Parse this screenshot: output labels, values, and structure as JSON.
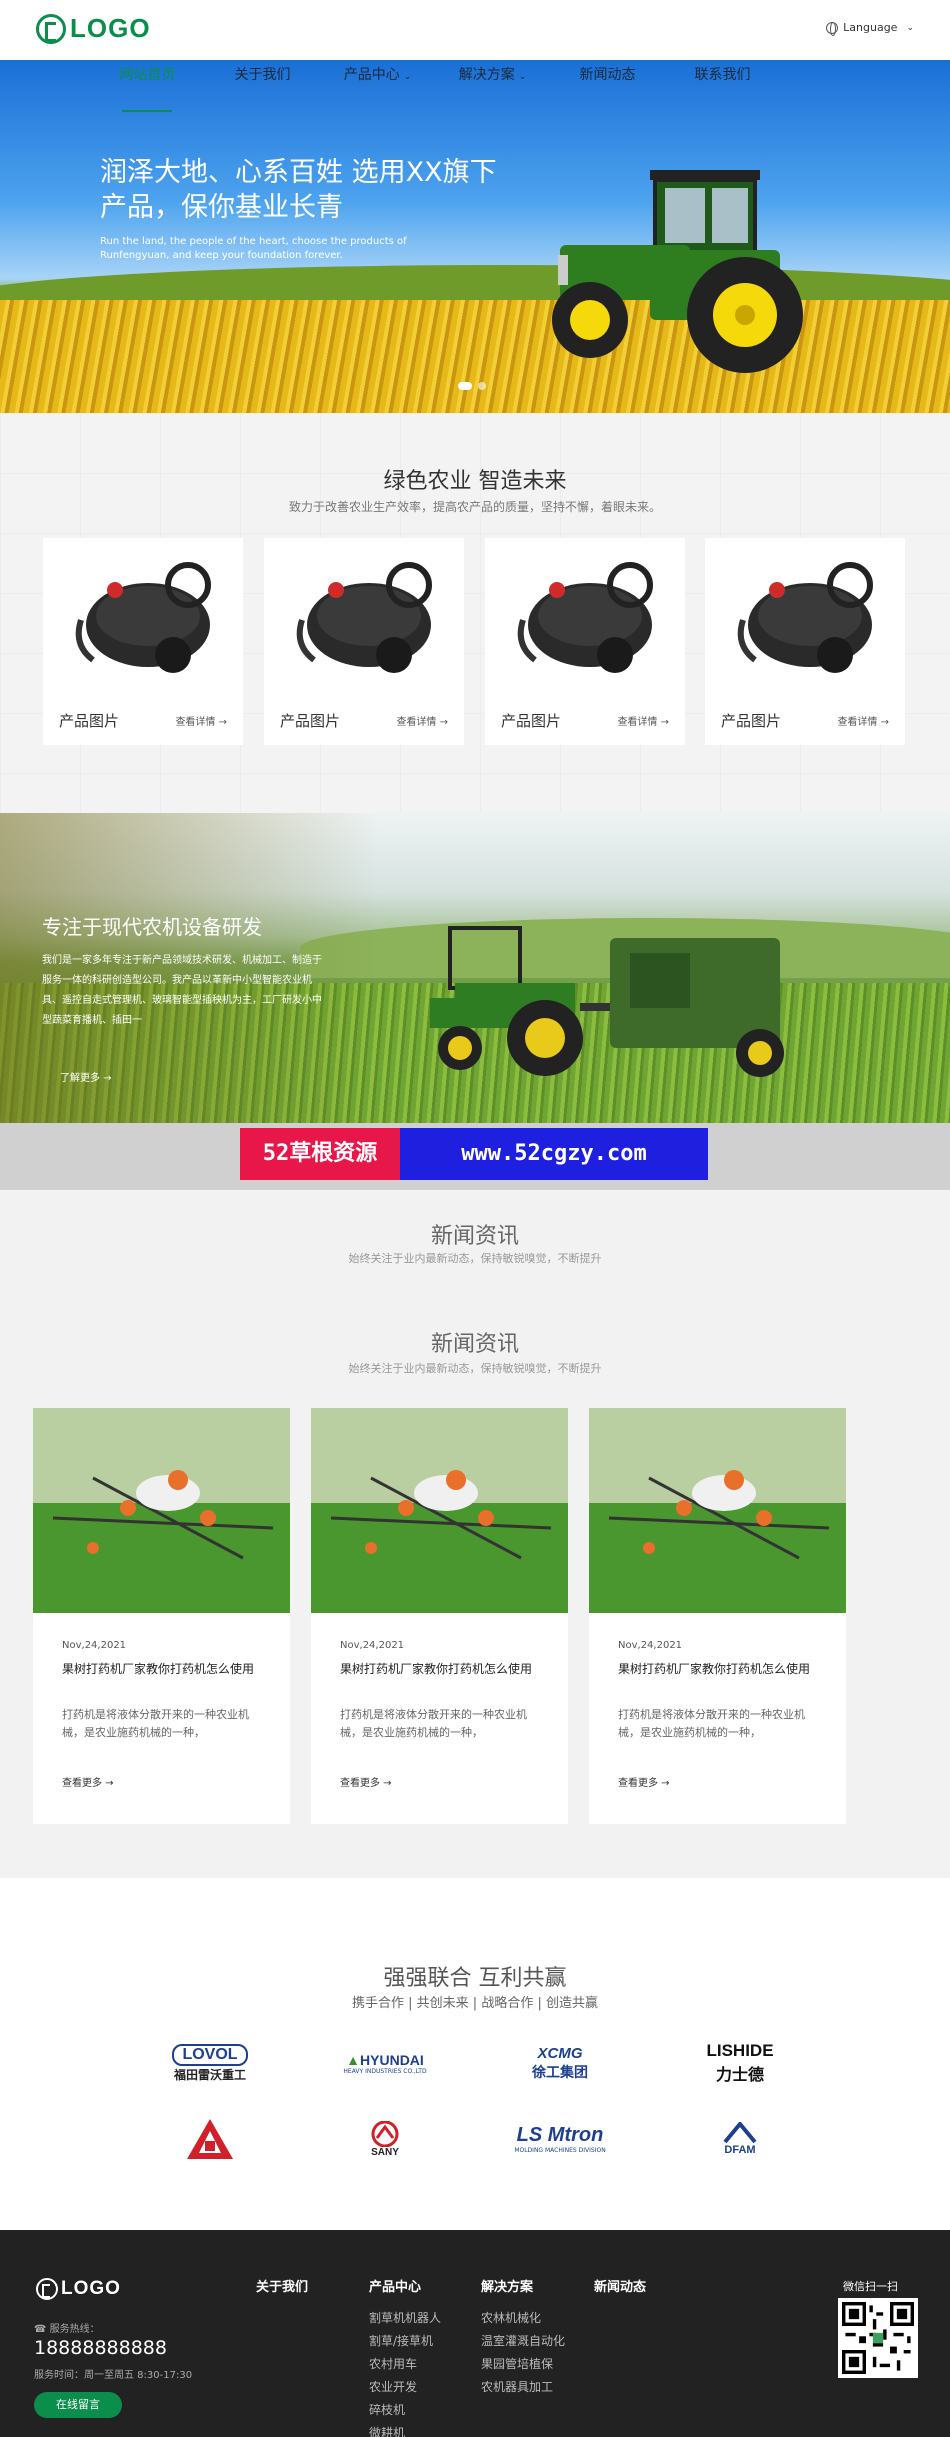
{
  "header": {
    "logo_text": "LOGO",
    "language_label": "Language"
  },
  "nav": {
    "items": [
      {
        "label": "网站首页",
        "active": true
      },
      {
        "label": "关于我们"
      },
      {
        "label": "产品中心",
        "has_dropdown": true
      },
      {
        "label": "解决方案",
        "has_dropdown": true
      },
      {
        "label": "新闻动态"
      },
      {
        "label": "联系我们"
      }
    ]
  },
  "hero": {
    "title": "润泽大地、心系百姓 选用XX旗下产品，保你基业长青",
    "subtitle": "Run the land, the people of the heart, choose the products of Runfengyuan, and keep your foundation forever."
  },
  "products": {
    "title": "绿色农业 智造未来",
    "subtitle": "致力于改善农业生产效率，提高农产品的质量，坚持不懈，着眼未来。",
    "items": [
      {
        "label": "产品图片",
        "more": "查看详情"
      },
      {
        "label": "产品图片",
        "more": "查看详情"
      },
      {
        "label": "产品图片",
        "more": "查看详情"
      },
      {
        "label": "产品图片",
        "more": "查看详情"
      }
    ]
  },
  "feature": {
    "title": "专注于现代农机设备研发",
    "text": "我们是一家多年专注于新产品领域技术研发、机械加工、制造于服务一体的科研创造型公司。我产品以革新中小型智能农业机具、遥控自走式管理机、玻璃智能型插秧机为主，工厂研发小中型蔬菜育播机、插田一",
    "more": "了解更多"
  },
  "watermark": {
    "red_label": "52草根资源",
    "blue_label": "www.52cgzy.com"
  },
  "news_header_1": {
    "title": "新闻资讯",
    "subtitle": "始终关注于业内最新动态，保持敏锐嗅觉，不断提升"
  },
  "news_header_2": {
    "title": "新闻资讯",
    "subtitle": "始终关注于业内最新动态，保持敏锐嗅觉，不断提升"
  },
  "news": [
    {
      "date": "Nov,24,2021",
      "title": "果树打药机厂家教你打药机怎么使用",
      "desc": "打药机是将液体分散开来的一种农业机械，是农业施药机械的一种，",
      "more": "查看更多"
    },
    {
      "date": "Nov,24,2021",
      "title": "果树打药机厂家教你打药机怎么使用",
      "desc": "打药机是将液体分散开来的一种农业机械，是农业施药机械的一种，",
      "more": "查看更多"
    },
    {
      "date": "Nov,24,2021",
      "title": "果树打药机厂家教你打药机怎么使用",
      "desc": "打药机是将液体分散开来的一种农业机械，是农业施药机械的一种，",
      "more": "查看更多"
    }
  ],
  "partners": {
    "title": "强强联合 互利共赢",
    "subtitle": "携手合作 | 共创未来 | 战略合作 | 创造共赢",
    "logos": [
      {
        "name": "LOVOL",
        "sub": "福田雷沃重工",
        "color": "#1d3f8f"
      },
      {
        "name": "HYUNDAI",
        "sub": "HEAVY INDUSTRIES CO.,LTD",
        "color": "#1d3f8f"
      },
      {
        "name": "XCMG",
        "sub": "徐工集团",
        "color": "#1d3f8f"
      },
      {
        "name": "LISHIDE",
        "sub": "力士德",
        "color": "#111111"
      },
      {
        "name": "",
        "sub": "",
        "color": "#d0202a"
      },
      {
        "name": "SANY",
        "sub": "",
        "color": "#d0202a"
      },
      {
        "name": "LS Mtron",
        "sub": "MOLDING MACHINES DIVISION",
        "color": "#1d3f8f"
      },
      {
        "name": "DFAM",
        "sub": "",
        "color": "#1d3f8f"
      }
    ]
  },
  "footer": {
    "logo_text": "LOGO",
    "hotline_label": "服务热线：",
    "phone": "18888888888",
    "hours": "服务时间：周一至周五 8:30-17:30",
    "online_button": "在线留言",
    "columns": [
      {
        "title": "关于我们",
        "items": []
      },
      {
        "title": "产品中心",
        "items": [
          "割草机机器人",
          "割草/接草机",
          "农村用车",
          "农业开发",
          "碎枝机",
          "微耕机"
        ]
      },
      {
        "title": "解决方案",
        "items": [
          "农林机械化",
          "温室灌溉自动化",
          "果园管培植保",
          "农机器具加工"
        ]
      },
      {
        "title": "新闻动态",
        "items": []
      }
    ],
    "qr_label": "微信扫一扫"
  },
  "colors": {
    "brand": "#0b8d4c",
    "footer_bg": "#222222",
    "section_bg": "#f2f2f2"
  }
}
